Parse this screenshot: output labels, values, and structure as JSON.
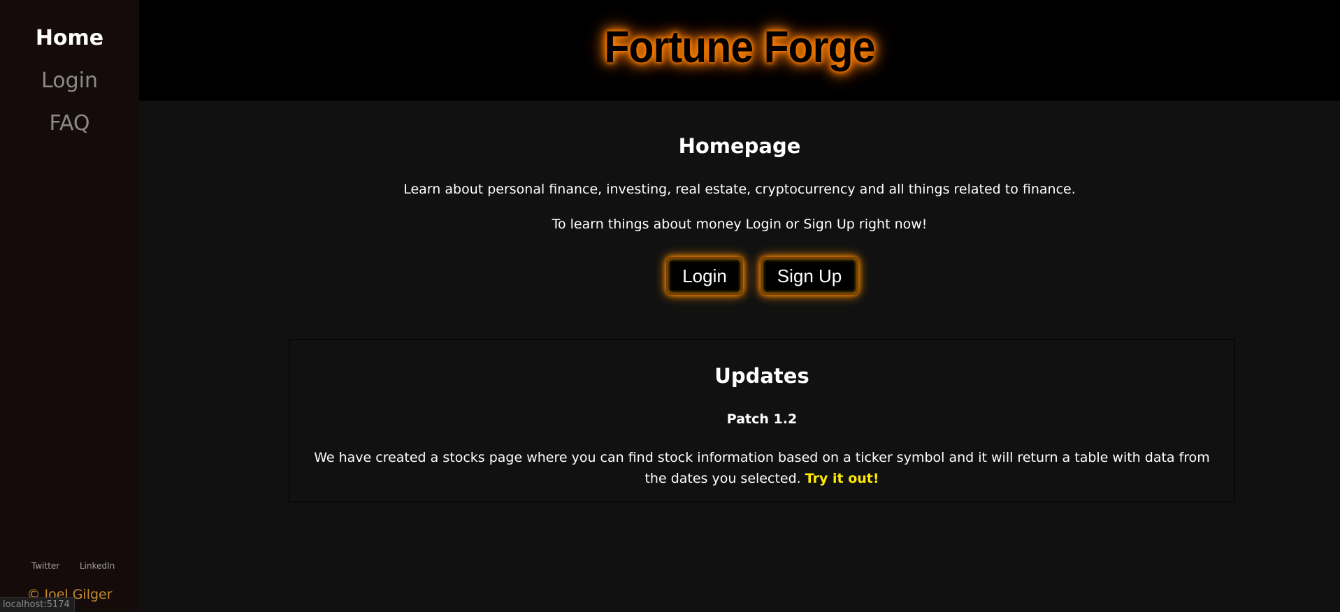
{
  "sidebar": {
    "items": [
      {
        "label": "Home"
      },
      {
        "label": "Login"
      },
      {
        "label": "FAQ"
      }
    ],
    "social": {
      "twitter": "Twitter",
      "linkedin": "LinkedIn"
    },
    "copyright": "© Joel Gilger"
  },
  "status_bar": {
    "url": "localhost:5174"
  },
  "header": {
    "logo": "Fortune Forge"
  },
  "main": {
    "title": "Homepage",
    "intro_line1": "Learn about personal finance, investing, real estate, cryptocurrency and all things related to finance.",
    "intro_line2": "To learn things about money Login or Sign Up right now!",
    "login_button": "Login",
    "signup_button": "Sign Up"
  },
  "updates": {
    "title": "Updates",
    "patch": "Patch 1.2",
    "body": "We have created a stocks page where you can find stock information based on a ticker symbol and it will return a table with data from the dates you selected.",
    "link": "Try it out!"
  },
  "colors": {
    "sidebar_bg": "#150b0a",
    "main_bg": "#111111",
    "header_bg": "#000000",
    "glow": "#ff8c00",
    "link": "#ffeb00",
    "copyright": "#c58a2e"
  }
}
